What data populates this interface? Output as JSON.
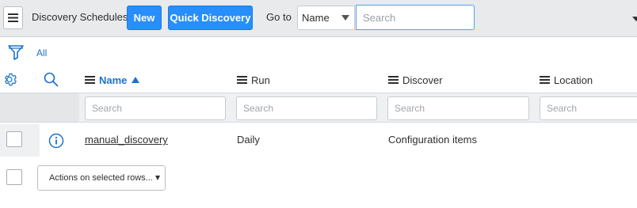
{
  "header": {
    "title": "Discovery Schedules",
    "new_label": "New",
    "quick_label": "Quick Discovery",
    "goto_label": "Go to",
    "goto_select_value": "Name",
    "goto_search_placeholder": "Search"
  },
  "filter": {
    "breadcrumb_label": "All"
  },
  "columns": [
    {
      "label": "Name",
      "sorted": "ascending",
      "search_placeholder": "Search"
    },
    {
      "label": "Run",
      "search_placeholder": "Search"
    },
    {
      "label": "Discover",
      "search_placeholder": "Search"
    },
    {
      "label": "Location",
      "search_placeholder": "Search"
    }
  ],
  "rows": [
    {
      "name": "manual_discovery",
      "run": "Daily",
      "discover": "Configuration items",
      "location": ""
    }
  ],
  "actions": {
    "label": "Actions on selected rows..."
  },
  "icons": {
    "menu": "hamburger-menu-icon",
    "filter": "funnel-filter-icon",
    "settings": "gear-icon",
    "search": "magnifier-search-icon",
    "info": "info-circle-icon"
  },
  "colors": {
    "primary_button": "#278efc",
    "link_blue": "#1a73c8",
    "header_bg": "#e8eaec"
  }
}
